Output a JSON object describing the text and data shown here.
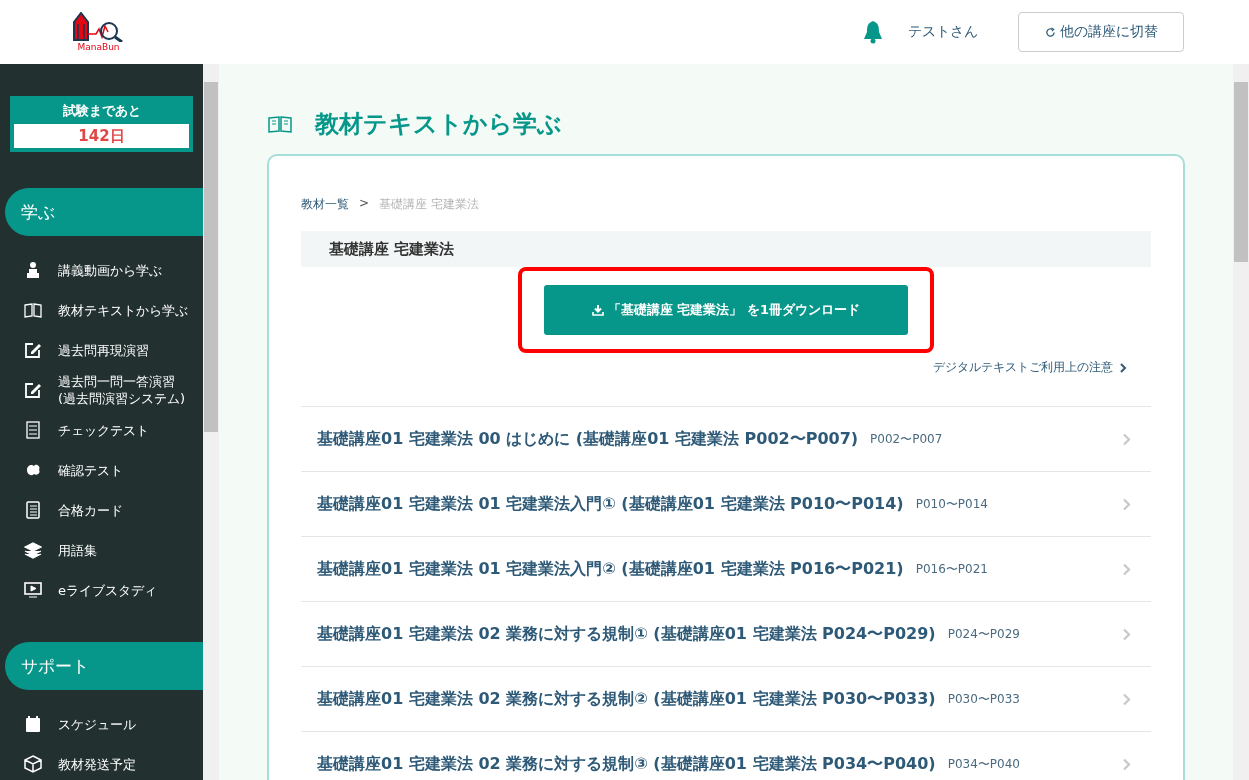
{
  "header": {
    "logo_text": "ManaBun",
    "user": "テストさん",
    "switch_button": "他の講座に切替"
  },
  "sidebar": {
    "countdown": {
      "label": "試験まであと",
      "value": "142日"
    },
    "sections": [
      {
        "title": "学ぶ",
        "items": [
          {
            "label": "講義動画から学ぶ"
          },
          {
            "label": "教材テキストから学ぶ"
          },
          {
            "label": "過去問再現演習"
          },
          {
            "label": "過去問一問一答演習\n(過去問演習システム)"
          },
          {
            "label": "チェックテスト"
          },
          {
            "label": "確認テスト"
          },
          {
            "label": "合格カード"
          },
          {
            "label": "用語集"
          },
          {
            "label": "eライブスタディ"
          }
        ]
      },
      {
        "title": "サポート",
        "items": [
          {
            "label": "スケジュール"
          },
          {
            "label": "教材発送予定"
          }
        ]
      }
    ]
  },
  "page": {
    "title": "教材テキストから学ぶ",
    "breadcrumb": [
      {
        "label": "教材一覧",
        "current": false
      },
      {
        "label": "基礎講座 宅建業法",
        "current": true
      }
    ],
    "breadcrumb_separator": ">",
    "section_title": "基礎講座 宅建業法",
    "download_button": {
      "label": "「基礎講座 宅建業法」 を1冊ダウンロード",
      "highlighted": true
    },
    "notice_link": "デジタルテキストご利用上の注意",
    "chapters": [
      {
        "title": "基礎講座01 宅建業法 00 はじめに (基礎講座01 宅建業法 P002〜P007)",
        "pages": "P002〜P007"
      },
      {
        "title": "基礎講座01 宅建業法 01 宅建業法入門① (基礎講座01 宅建業法 P010〜P014)",
        "pages": "P010〜P014"
      },
      {
        "title": "基礎講座01 宅建業法 01 宅建業法入門② (基礎講座01 宅建業法 P016〜P021)",
        "pages": "P016〜P021"
      },
      {
        "title": "基礎講座01 宅建業法 02 業務に対する規制① (基礎講座01 宅建業法 P024〜P029)",
        "pages": "P024〜P029"
      },
      {
        "title": "基礎講座01 宅建業法 02 業務に対する規制② (基礎講座01 宅建業法 P030〜P033)",
        "pages": "P030〜P033"
      },
      {
        "title": "基礎講座01 宅建業法 02 業務に対する規制③ (基礎講座01 宅建業法 P034〜P040)",
        "pages": "P034〜P040"
      }
    ]
  }
}
